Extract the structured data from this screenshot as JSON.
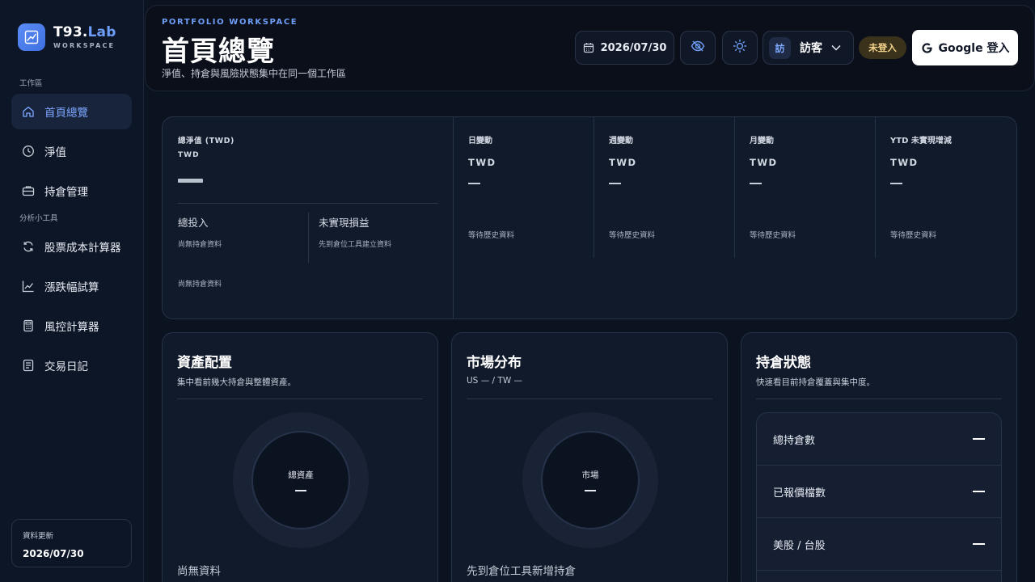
{
  "brand": {
    "name_prefix": "T93.",
    "name_accent": "Lab",
    "sub": "WORKSPACE"
  },
  "sidebar": {
    "section_workspace": "工作區",
    "section_tools": "分析小工具",
    "items": [
      {
        "label": "首頁總覽",
        "icon": "home-icon"
      },
      {
        "label": "淨值",
        "icon": "clock-icon"
      },
      {
        "label": "持倉管理",
        "icon": "briefcase-icon"
      },
      {
        "label": "股票成本計算器",
        "icon": "refresh-icon"
      },
      {
        "label": "漲跌幅試算",
        "icon": "trend-icon"
      },
      {
        "label": "風控計算器",
        "icon": "calculator-icon"
      },
      {
        "label": "交易日記",
        "icon": "journal-icon"
      }
    ],
    "update_label": "資料更新",
    "update_date": "2026/07/30"
  },
  "header": {
    "eyebrow": "PORTFOLIO WORKSPACE",
    "title": "首頁總覽",
    "description": "淨值、持倉與風險狀態集中在同一個工作區",
    "date": "2026/07/30",
    "user_avatar": "訪",
    "user_name": "訪客",
    "login_status": "未登入",
    "google_login": "Google 登入"
  },
  "summary": {
    "net_value_label": "總淨值 (TWD)",
    "net_value_currency": "TWD",
    "total_invested_label": "總投入",
    "total_invested_note": "尚無持倉資料",
    "unrealized_label": "未實現損益",
    "unrealized_note": "先到倉位工具建立資料",
    "footer_note": "尚無持倉資料",
    "metrics": [
      {
        "label": "日變動",
        "currency": "TWD",
        "note": "等待歷史資料"
      },
      {
        "label": "週變動",
        "currency": "TWD",
        "note": "等待歷史資料"
      },
      {
        "label": "月變動",
        "currency": "TWD",
        "note": "等待歷史資料"
      },
      {
        "label": "YTD 未實現增減",
        "currency": "TWD",
        "note": "等待歷史資料"
      }
    ]
  },
  "allocation": {
    "title": "資產配置",
    "description": "集中看前幾大持倉與整體資產。",
    "center_label": "總資產",
    "empty": "尚無資料"
  },
  "market": {
    "title": "市場分布",
    "description": "US — / TW —",
    "center_label": "市場",
    "empty": "先到倉位工具新增持倉"
  },
  "holdings": {
    "title": "持倉狀態",
    "description": "快速看目前持倉覆蓋與集中度。",
    "rows": [
      {
        "label": "總持倉數"
      },
      {
        "label": "已報價檔數"
      },
      {
        "label": "美股 / 台股"
      }
    ]
  },
  "colors": {
    "accent": "#6f9ef8",
    "background": "#0b1220",
    "card": "#111a2b",
    "badge": "#f3d28a"
  }
}
